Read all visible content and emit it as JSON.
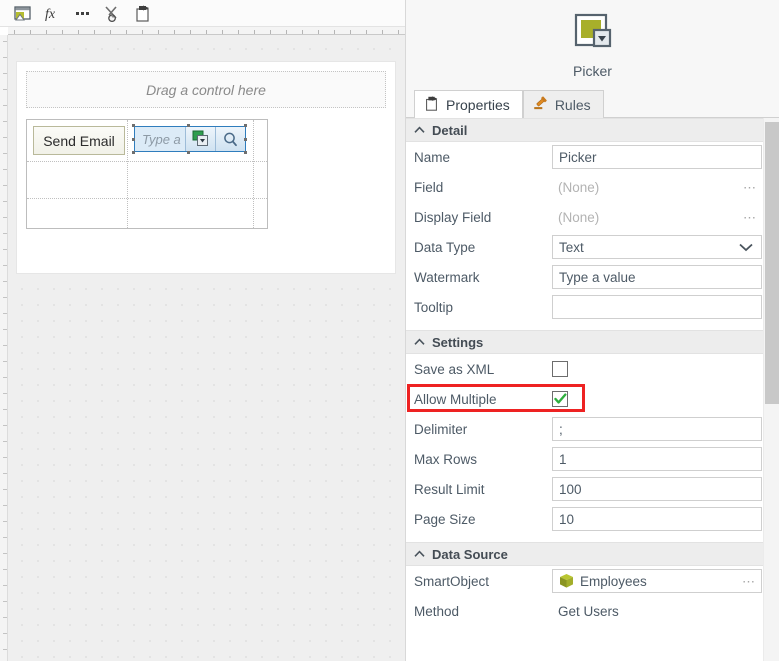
{
  "designer": {
    "toolbar": {
      "buttons": [
        {
          "name": "open-view-icon",
          "title": "Open View"
        },
        {
          "name": "function-fx-icon",
          "title": "Expression"
        },
        {
          "name": "ellipsis-icon",
          "title": "More"
        },
        {
          "name": "cut-transfer-icon",
          "title": "Transfer / Cut"
        },
        {
          "name": "paste-properties-icon",
          "title": "Properties"
        }
      ]
    },
    "canvas": {
      "drop_zone_text": "Drag a control here",
      "send_email_button": "Send Email",
      "picker": {
        "watermark": "Type a",
        "picker_button_icon": "picker-dropdown-icon",
        "search_button_icon": "magnifier-icon"
      }
    }
  },
  "properties_panel": {
    "header": {
      "icon": "picker-control-icon",
      "title": "Picker"
    },
    "tabs": [
      {
        "label": "Properties",
        "icon": "properties-clipboard-icon",
        "active": true
      },
      {
        "label": "Rules",
        "icon": "gavel-icon",
        "active": false
      }
    ],
    "sections": [
      {
        "id": "detail",
        "title": "Detail",
        "collapsed": false,
        "rows": [
          {
            "label": "Name",
            "type": "text",
            "value": "Picker",
            "muted": false,
            "ellipsis": false
          },
          {
            "label": "Field",
            "type": "text",
            "value": "(None)",
            "muted": true,
            "ellipsis": true
          },
          {
            "label": "Display Field",
            "type": "text",
            "value": "(None)",
            "muted": true,
            "ellipsis": true
          },
          {
            "label": "Data Type",
            "type": "dropdown",
            "value": "Text",
            "muted": false,
            "ellipsis": false
          },
          {
            "label": "Watermark",
            "type": "text",
            "value": "Type a value",
            "muted": false,
            "ellipsis": false
          },
          {
            "label": "Tooltip",
            "type": "text",
            "value": "",
            "muted": false,
            "ellipsis": false
          }
        ]
      },
      {
        "id": "settings",
        "title": "Settings",
        "collapsed": false,
        "rows": [
          {
            "label": "Save as XML",
            "type": "checkbox",
            "checked": false
          },
          {
            "label": "Allow Multiple",
            "type": "checkbox",
            "checked": true,
            "highlighted": true
          },
          {
            "label": "Delimiter",
            "type": "text",
            "value": ";"
          },
          {
            "label": "Max Rows",
            "type": "text",
            "value": "1"
          },
          {
            "label": "Result Limit",
            "type": "text",
            "value": "100"
          },
          {
            "label": "Page Size",
            "type": "text",
            "value": "10"
          }
        ]
      },
      {
        "id": "data-source",
        "title": "Data Source",
        "collapsed": false,
        "rows": [
          {
            "label": "SmartObject",
            "type": "icon-text",
            "value": "Employees",
            "icon": "smartobject-cube-icon",
            "ellipsis": true
          },
          {
            "label": "Method",
            "type": "plain",
            "value": "Get Users"
          }
        ]
      }
    ],
    "scrollbar": {
      "visible": true
    }
  },
  "colors": {
    "accent_olive": "#a8af2a",
    "picker_border_blue": "#2f7dbd",
    "picker_fill_blue": "#dcebf7",
    "highlight_red": "#ee2222",
    "check_green": "#2faf3e",
    "section_header_bg": "#ededed",
    "label_text": "#4d5a66"
  }
}
